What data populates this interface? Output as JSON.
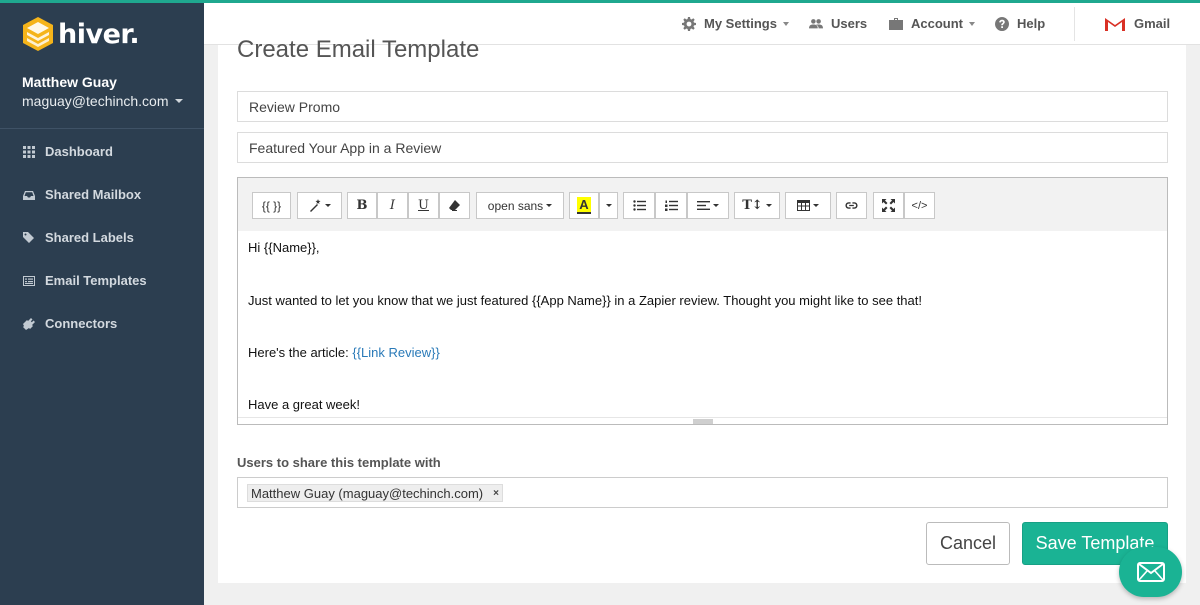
{
  "app": {
    "logo_text": "hiver."
  },
  "user": {
    "name": "Matthew Guay",
    "email": "maguay@techinch.com"
  },
  "sidebar": {
    "items": [
      {
        "label": "Dashboard",
        "icon": "grid-icon"
      },
      {
        "label": "Shared Mailbox",
        "icon": "inbox-icon"
      },
      {
        "label": "Shared Labels",
        "icon": "tags-icon"
      },
      {
        "label": "Email Templates",
        "icon": "template-icon"
      },
      {
        "label": "Connectors",
        "icon": "plug-icon"
      }
    ]
  },
  "topbar": {
    "my_settings": "My Settings",
    "users": "Users",
    "account": "Account",
    "help": "Help",
    "gmail": "Gmail"
  },
  "page": {
    "title": "Create Email Template"
  },
  "form": {
    "template_name": "Review Promo",
    "subject": "Featured Your App in a Review"
  },
  "editor": {
    "toolbar": {
      "variables": "{{ }}",
      "font": "open sans",
      "highlight": "A"
    },
    "body": {
      "line1": "Hi {{Name}},",
      "line2": "Just wanted to let you know that we just featured {{App Name}} in a Zapier review. Thought you might like to see that!",
      "line3_prefix": "Here's the article: ",
      "line3_link": "{{Link Review}}",
      "line4": "Have a great week!"
    }
  },
  "share": {
    "label": "Users to share this template with",
    "chip": "Matthew Guay (maguay@techinch.com)",
    "chip_remove": "×"
  },
  "actions": {
    "cancel": "Cancel",
    "save": "Save Template"
  },
  "colors": {
    "sidebar": "#2c3e50",
    "accent": "#1ab394",
    "link": "#2a7ab8",
    "logo": "#f5b41a"
  }
}
